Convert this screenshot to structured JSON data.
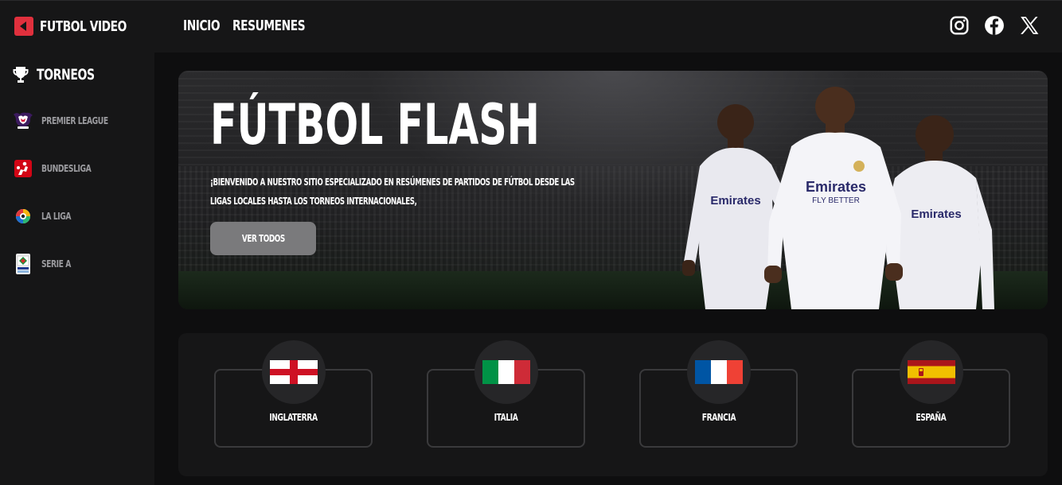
{
  "brand": {
    "name": "FUTBOL VIDEO",
    "accent": "#e0303d"
  },
  "nav": {
    "items": [
      "INICIO",
      "RESUMENES"
    ]
  },
  "socials": [
    "instagram-icon",
    "facebook-icon",
    "x-icon"
  ],
  "sidebar": {
    "title": "TORNEOS",
    "items": [
      {
        "label": "PREMIER LEAGUE",
        "icon": "premier-league-logo"
      },
      {
        "label": "BUNDESLIGA",
        "icon": "bundesliga-logo"
      },
      {
        "label": "LA LIGA",
        "icon": "la-liga-logo"
      },
      {
        "label": "SERIE A",
        "icon": "serie-a-logo"
      }
    ]
  },
  "hero": {
    "title": "FÚTBOL FLASH",
    "description": "¡Bienvenido a nuestro sitio especializado en resúmenes de partidos de fútbol desde las ligas locales hasta los torneos internacionales,",
    "button": "VER TODOS"
  },
  "countries": [
    {
      "name": "INGLATERRA",
      "flag": "england-flag"
    },
    {
      "name": "ITALIA",
      "flag": "italy-flag"
    },
    {
      "name": "FRANCIA",
      "flag": "france-flag"
    },
    {
      "name": "ESPAÑA",
      "flag": "spain-flag"
    }
  ]
}
